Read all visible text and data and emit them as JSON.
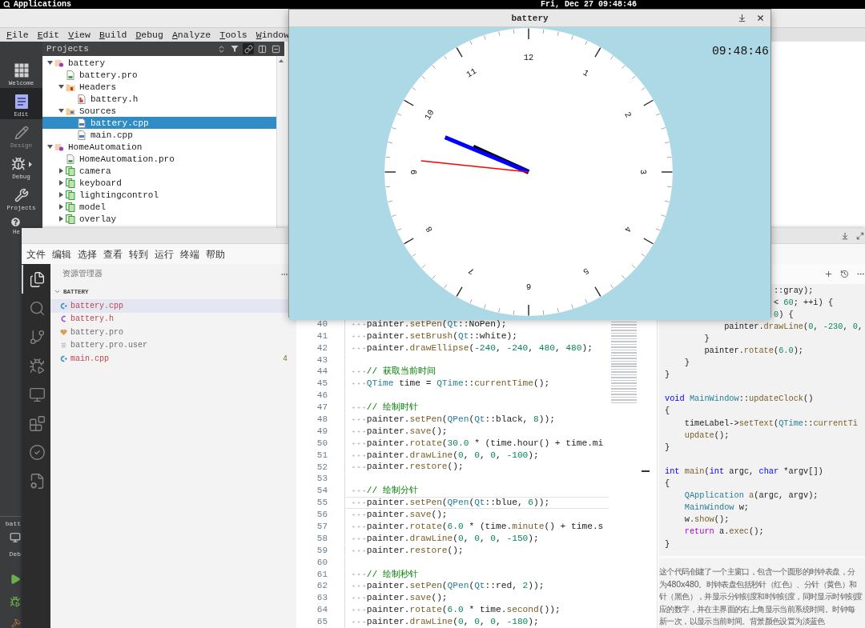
{
  "top_bar": {
    "menu": "Applications",
    "date_time": "Fri, Dec 27 09:48:46"
  },
  "qt_creator": {
    "menu": [
      "File",
      "Edit",
      "View",
      "Build",
      "Debug",
      "Analyze",
      "Tools",
      "Window"
    ],
    "modes": [
      {
        "kind": "welcome",
        "label": "Welcome",
        "selected": false,
        "disabled": false
      },
      {
        "kind": "edit",
        "label": "Edit",
        "selected": true,
        "disabled": false
      },
      {
        "kind": "design",
        "label": "Design",
        "selected": false,
        "disabled": true
      },
      {
        "kind": "debug",
        "label": "Debug",
        "selected": false,
        "disabled": false
      },
      {
        "kind": "projects",
        "label": "Projects",
        "selected": false,
        "disabled": false
      },
      {
        "kind": "help",
        "label": "He",
        "selected": false,
        "disabled": false
      }
    ],
    "kit": {
      "project": "batt",
      "build": "Deb"
    },
    "run_buttons": [
      {
        "kind": "run"
      },
      {
        "kind": "debug"
      },
      {
        "kind": "build"
      }
    ],
    "projects_panel": {
      "title": "Projects",
      "tools": [
        {
          "kind": "sort",
          "on": false
        },
        {
          "kind": "filter",
          "on": false
        },
        {
          "kind": "link",
          "on": true
        },
        {
          "kind": "split",
          "on": false
        },
        {
          "kind": "close",
          "on": false
        }
      ],
      "tree": [
        {
          "kind": "project",
          "label": "battery",
          "expanded": true,
          "selected": false,
          "children": [
            {
              "kind": "pro_file",
              "label": "battery.pro",
              "selected": false
            },
            {
              "kind": "headers",
              "label": "Headers",
              "expanded": true,
              "selected": false,
              "children": [
                {
                  "kind": "header_file",
                  "label": "battery.h",
                  "selected": false
                }
              ]
            },
            {
              "kind": "sources",
              "label": "Sources",
              "expanded": true,
              "selected": false,
              "children": [
                {
                  "kind": "cpp_file",
                  "label": "battery.cpp",
                  "selected": true
                },
                {
                  "kind": "cpp_file",
                  "label": "main.cpp",
                  "selected": false
                }
              ]
            }
          ]
        },
        {
          "kind": "project",
          "label": "HomeAutomation",
          "expanded": true,
          "selected": false,
          "children": [
            {
              "kind": "pro_file",
              "label": "HomeAutomation.pro",
              "selected": false
            },
            {
              "kind": "subproject",
              "label": "camera",
              "expanded": false,
              "selected": false
            },
            {
              "kind": "subproject",
              "label": "keyboard",
              "expanded": false,
              "selected": false
            },
            {
              "kind": "subproject",
              "label": "lightingcontrol",
              "expanded": false,
              "selected": false
            },
            {
              "kind": "subproject",
              "label": "model",
              "expanded": false,
              "selected": false
            },
            {
              "kind": "subproject",
              "label": "overlay",
              "expanded": false,
              "selected": false
            }
          ]
        }
      ]
    }
  },
  "clock_window": {
    "title": "battery",
    "time": "09:48:46",
    "dial_numbers": [
      "12",
      "1",
      "2",
      "3",
      "4",
      "5",
      "6",
      "7",
      "8",
      "9",
      "10",
      "11"
    ],
    "hands": [
      {
        "kind": "hour",
        "color": "#000000"
      },
      {
        "kind": "minute",
        "color": "#0000ff"
      },
      {
        "kind": "second",
        "color": "#ff0000"
      }
    ]
  },
  "vscode": {
    "menu": [
      "文件",
      "编辑",
      "选择",
      "查看",
      "转到",
      "运行",
      "终端",
      "帮助"
    ],
    "activity_bar": [
      {
        "kind": "explorer",
        "selected": true
      },
      {
        "kind": "search",
        "selected": false
      },
      {
        "kind": "source_control",
        "selected": false
      },
      {
        "kind": "run",
        "selected": false
      },
      {
        "kind": "remote",
        "selected": false
      },
      {
        "kind": "extensions",
        "selected": false
      },
      {
        "kind": "testing",
        "selected": false
      },
      {
        "kind": "cpp",
        "selected": false
      }
    ],
    "explorer": {
      "title": "资源管理器",
      "folder": {
        "label": "BATTERY",
        "expanded": true
      },
      "files": [
        {
          "kind": "cpp",
          "name": "battery.cpp",
          "selected": true,
          "error": true
        },
        {
          "kind": "header",
          "name": "battery.h",
          "selected": false,
          "error": true
        },
        {
          "kind": "project",
          "name": "battery.pro",
          "selected": false,
          "error": false
        },
        {
          "kind": "text",
          "name": "battery.pro.user",
          "selected": false,
          "error": false
        },
        {
          "kind": "cpp",
          "name": "main.cpp",
          "selected": false,
          "error": true,
          "problems": "4"
        }
      ]
    },
    "editor": {
      "lines": [
        {
          "number": "40",
          "current": false,
          "tokens": [
            {
              "kind": "plain",
              "text": "    painter."
            },
            {
              "kind": "function",
              "text": "setPen"
            },
            {
              "kind": "plain",
              "text": "("
            },
            {
              "kind": "type",
              "text": "Qt"
            },
            {
              "kind": "plain",
              "text": "::NoPen);"
            }
          ]
        },
        {
          "number": "41",
          "current": false,
          "tokens": [
            {
              "kind": "plain",
              "text": "    painter."
            },
            {
              "kind": "function",
              "text": "setBrush"
            },
            {
              "kind": "plain",
              "text": "("
            },
            {
              "kind": "type",
              "text": "Qt"
            },
            {
              "kind": "plain",
              "text": "::white);"
            }
          ]
        },
        {
          "number": "42",
          "current": false,
          "tokens": [
            {
              "kind": "plain",
              "text": "    painter."
            },
            {
              "kind": "function",
              "text": "drawEllipse"
            },
            {
              "kind": "plain",
              "text": "("
            },
            {
              "kind": "number",
              "text": "-240"
            },
            {
              "kind": "plain",
              "text": ", "
            },
            {
              "kind": "number",
              "text": "-240"
            },
            {
              "kind": "plain",
              "text": ", "
            },
            {
              "kind": "number",
              "text": "480"
            },
            {
              "kind": "plain",
              "text": ", "
            },
            {
              "kind": "number",
              "text": "480"
            },
            {
              "kind": "plain",
              "text": ");"
            }
          ]
        },
        {
          "number": "43",
          "current": false
        },
        {
          "number": "44",
          "current": false,
          "tokens": [
            {
              "kind": "comment",
              "text": "    // 获取当前时间"
            }
          ]
        },
        {
          "number": "45",
          "current": false,
          "tokens": [
            {
              "kind": "type",
              "text": "    QTime"
            },
            {
              "kind": "plain",
              "text": " time = "
            },
            {
              "kind": "type",
              "text": "QTime"
            },
            {
              "kind": "plain",
              "text": "::"
            },
            {
              "kind": "function",
              "text": "currentTime"
            },
            {
              "kind": "plain",
              "text": "();"
            }
          ]
        },
        {
          "number": "46",
          "current": false
        },
        {
          "number": "47",
          "current": false,
          "tokens": [
            {
              "kind": "comment",
              "text": "    // 绘制时针"
            }
          ]
        },
        {
          "number": "48",
          "current": false,
          "tokens": [
            {
              "kind": "plain",
              "text": "    painter."
            },
            {
              "kind": "function",
              "text": "setPen"
            },
            {
              "kind": "plain",
              "text": "("
            },
            {
              "kind": "type",
              "text": "QPen"
            },
            {
              "kind": "plain",
              "text": "("
            },
            {
              "kind": "type",
              "text": "Qt"
            },
            {
              "kind": "plain",
              "text": "::black, "
            },
            {
              "kind": "number",
              "text": "8"
            },
            {
              "kind": "plain",
              "text": "));"
            }
          ]
        },
        {
          "number": "49",
          "current": false,
          "tokens": [
            {
              "kind": "plain",
              "text": "    painter."
            },
            {
              "kind": "function",
              "text": "save"
            },
            {
              "kind": "plain",
              "text": "();"
            }
          ]
        },
        {
          "number": "50",
          "current": false,
          "tokens": [
            {
              "kind": "plain",
              "text": "    painter."
            },
            {
              "kind": "function",
              "text": "rotate"
            },
            {
              "kind": "plain",
              "text": "("
            },
            {
              "kind": "number",
              "text": "30.0"
            },
            {
              "kind": "plain",
              "text": " * (time.hour() + time.mi"
            }
          ]
        },
        {
          "number": "51",
          "current": false,
          "tokens": [
            {
              "kind": "plain",
              "text": "    painter."
            },
            {
              "kind": "function",
              "text": "drawLine"
            },
            {
              "kind": "plain",
              "text": "("
            },
            {
              "kind": "number",
              "text": "0"
            },
            {
              "kind": "plain",
              "text": ", "
            },
            {
              "kind": "number",
              "text": "0"
            },
            {
              "kind": "plain",
              "text": ", "
            },
            {
              "kind": "number",
              "text": "0"
            },
            {
              "kind": "plain",
              "text": ", "
            },
            {
              "kind": "number",
              "text": "-100"
            },
            {
              "kind": "plain",
              "text": ");"
            }
          ]
        },
        {
          "number": "52",
          "current": false,
          "tokens": [
            {
              "kind": "plain",
              "text": "    painter."
            },
            {
              "kind": "function",
              "text": "restore"
            },
            {
              "kind": "plain",
              "text": "();"
            }
          ]
        },
        {
          "number": "53",
          "current": false
        },
        {
          "number": "54",
          "current": false,
          "tokens": [
            {
              "kind": "comment",
              "text": "    // 绘制分针"
            }
          ]
        },
        {
          "number": "55",
          "current": true,
          "tokens": [
            {
              "kind": "plain",
              "text": "    painter."
            },
            {
              "kind": "function",
              "text": "setPen"
            },
            {
              "kind": "plain",
              "text": "("
            },
            {
              "kind": "type",
              "text": "QPen"
            },
            {
              "kind": "plain",
              "text": "("
            },
            {
              "kind": "type",
              "text": "Qt"
            },
            {
              "kind": "plain",
              "text": "::blue, "
            },
            {
              "kind": "number",
              "text": "6"
            },
            {
              "kind": "plain",
              "text": "));"
            }
          ]
        },
        {
          "number": "56",
          "current": false,
          "tokens": [
            {
              "kind": "plain",
              "text": "    painter."
            },
            {
              "kind": "function",
              "text": "save"
            },
            {
              "kind": "plain",
              "text": "();"
            }
          ]
        },
        {
          "number": "57",
          "current": false,
          "tokens": [
            {
              "kind": "plain",
              "text": "    painter."
            },
            {
              "kind": "function",
              "text": "rotate"
            },
            {
              "kind": "plain",
              "text": "("
            },
            {
              "kind": "number",
              "text": "6.0"
            },
            {
              "kind": "plain",
              "text": " * (time."
            },
            {
              "kind": "function",
              "text": "minute"
            },
            {
              "kind": "plain",
              "text": "() + time.s"
            }
          ]
        },
        {
          "number": "58",
          "current": false,
          "tokens": [
            {
              "kind": "plain",
              "text": "    painter."
            },
            {
              "kind": "function",
              "text": "drawLine"
            },
            {
              "kind": "plain",
              "text": "("
            },
            {
              "kind": "number",
              "text": "0"
            },
            {
              "kind": "plain",
              "text": ", "
            },
            {
              "kind": "number",
              "text": "0"
            },
            {
              "kind": "plain",
              "text": ", "
            },
            {
              "kind": "number",
              "text": "0"
            },
            {
              "kind": "plain",
              "text": ", "
            },
            {
              "kind": "number",
              "text": "-150"
            },
            {
              "kind": "plain",
              "text": ");"
            }
          ]
        },
        {
          "number": "59",
          "current": false,
          "tokens": [
            {
              "kind": "plain",
              "text": "    painter."
            },
            {
              "kind": "function",
              "text": "restore"
            },
            {
              "kind": "plain",
              "text": "();"
            }
          ]
        },
        {
          "number": "60",
          "current": false
        },
        {
          "number": "61",
          "current": false,
          "tokens": [
            {
              "kind": "comment",
              "text": "    // 绘制秒针"
            }
          ]
        },
        {
          "number": "62",
          "current": false,
          "tokens": [
            {
              "kind": "plain",
              "text": "    painter."
            },
            {
              "kind": "function",
              "text": "setPen"
            },
            {
              "kind": "plain",
              "text": "("
            },
            {
              "kind": "type",
              "text": "QPen"
            },
            {
              "kind": "plain",
              "text": "("
            },
            {
              "kind": "type",
              "text": "Qt"
            },
            {
              "kind": "plain",
              "text": "::red, "
            },
            {
              "kind": "number",
              "text": "2"
            },
            {
              "kind": "plain",
              "text": "));"
            }
          ]
        },
        {
          "number": "63",
          "current": false,
          "tokens": [
            {
              "kind": "plain",
              "text": "    painter."
            },
            {
              "kind": "function",
              "text": "save"
            },
            {
              "kind": "plain",
              "text": "();"
            }
          ]
        },
        {
          "number": "64",
          "current": false,
          "tokens": [
            {
              "kind": "plain",
              "text": "    painter."
            },
            {
              "kind": "function",
              "text": "rotate"
            },
            {
              "kind": "plain",
              "text": "("
            },
            {
              "kind": "number",
              "text": "6.0"
            },
            {
              "kind": "plain",
              "text": " * time."
            },
            {
              "kind": "function",
              "text": "second"
            },
            {
              "kind": "plain",
              "text": "());"
            }
          ]
        },
        {
          "number": "65",
          "current": false,
          "tokens": [
            {
              "kind": "plain",
              "text": "    painter."
            },
            {
              "kind": "function",
              "text": "drawLine"
            },
            {
              "kind": "plain",
              "text": "("
            },
            {
              "kind": "number",
              "text": "0"
            },
            {
              "kind": "plain",
              "text": ", "
            },
            {
              "kind": "number",
              "text": "0"
            },
            {
              "kind": "plain",
              "text": ", "
            },
            {
              "kind": "number",
              "text": "0"
            },
            {
              "kind": "plain",
              "text": ", "
            },
            {
              "kind": "number",
              "text": "-180"
            },
            {
              "kind": "plain",
              "text": ");"
            }
          ]
        }
      ]
    },
    "chat_panel": {
      "code_lines": [
        {
          "kind": "code",
          "tokens": [
            {
              "kind": "plain",
              "text": "                      ::gray);"
            }
          ]
        },
        {
          "kind": "code",
          "tokens": [
            {
              "kind": "plain",
              "text": "                      < "
            },
            {
              "kind": "number",
              "text": "60"
            },
            {
              "kind": "plain",
              "text": "; ++i) {"
            }
          ]
        },
        {
          "kind": "code",
          "tokens": [
            {
              "kind": "number",
              "text": "                      0"
            },
            {
              "kind": "plain",
              "text": ") {"
            }
          ]
        },
        {
          "kind": "code",
          "tokens": [
            {
              "kind": "plain",
              "text": "            painter."
            },
            {
              "kind": "function",
              "text": "drawLine"
            },
            {
              "kind": "plain",
              "text": "("
            },
            {
              "kind": "number",
              "text": "0"
            },
            {
              "kind": "plain",
              "text": ", "
            },
            {
              "kind": "number",
              "text": "-230"
            },
            {
              "kind": "plain",
              "text": ", "
            },
            {
              "kind": "number",
              "text": "0"
            },
            {
              "kind": "plain",
              "text": ","
            }
          ]
        },
        {
          "kind": "code",
          "tokens": [
            {
              "kind": "plain",
              "text": "        }"
            }
          ]
        },
        {
          "kind": "code",
          "tokens": [
            {
              "kind": "plain",
              "text": "        painter."
            },
            {
              "kind": "function",
              "text": "rotate"
            },
            {
              "kind": "plain",
              "text": "("
            },
            {
              "kind": "number",
              "text": "6.0"
            },
            {
              "kind": "plain",
              "text": ");"
            }
          ]
        },
        {
          "kind": "code",
          "tokens": [
            {
              "kind": "plain",
              "text": "    }"
            }
          ]
        },
        {
          "kind": "code",
          "tokens": [
            {
              "kind": "plain",
              "text": "}"
            }
          ]
        },
        {
          "kind": "blank"
        },
        {
          "kind": "code",
          "tokens": [
            {
              "kind": "keyword",
              "text": "void"
            },
            {
              "kind": "type",
              "text": " MainWindow"
            },
            {
              "kind": "plain",
              "text": "::"
            },
            {
              "kind": "function",
              "text": "updateClock"
            },
            {
              "kind": "plain",
              "text": "()"
            }
          ]
        },
        {
          "kind": "code",
          "tokens": [
            {
              "kind": "plain",
              "text": "{"
            }
          ]
        },
        {
          "kind": "code",
          "tokens": [
            {
              "kind": "plain",
              "text": "    timeLabel->"
            },
            {
              "kind": "function",
              "text": "setText"
            },
            {
              "kind": "plain",
              "text": "("
            },
            {
              "kind": "type",
              "text": "QTime"
            },
            {
              "kind": "plain",
              "text": "::"
            },
            {
              "kind": "function",
              "text": "currentTi"
            }
          ]
        },
        {
          "kind": "code",
          "tokens": [
            {
              "kind": "function",
              "text": "    update"
            },
            {
              "kind": "plain",
              "text": "();"
            }
          ]
        },
        {
          "kind": "code",
          "tokens": [
            {
              "kind": "plain",
              "text": "}"
            }
          ]
        },
        {
          "kind": "blank"
        },
        {
          "kind": "code",
          "tokens": [
            {
              "kind": "keyword",
              "text": "int"
            },
            {
              "kind": "function",
              "text": " main"
            },
            {
              "kind": "plain",
              "text": "("
            },
            {
              "kind": "keyword",
              "text": "int"
            },
            {
              "kind": "plain",
              "text": " argc, "
            },
            {
              "kind": "keyword",
              "text": "char"
            },
            {
              "kind": "plain",
              "text": " *argv[])"
            }
          ]
        },
        {
          "kind": "code",
          "tokens": [
            {
              "kind": "plain",
              "text": "{"
            }
          ]
        },
        {
          "kind": "code",
          "tokens": [
            {
              "kind": "type",
              "text": "    QApplication"
            },
            {
              "kind": "function",
              "text": " a"
            },
            {
              "kind": "plain",
              "text": "(argc, argv);"
            }
          ]
        },
        {
          "kind": "code",
          "tokens": [
            {
              "kind": "type",
              "text": "    MainWindow"
            },
            {
              "kind": "plain",
              "text": " w;"
            }
          ]
        },
        {
          "kind": "code",
          "tokens": [
            {
              "kind": "plain",
              "text": "    w."
            },
            {
              "kind": "function",
              "text": "show"
            },
            {
              "kind": "plain",
              "text": "();"
            }
          ]
        },
        {
          "kind": "code",
          "tokens": [
            {
              "kind": "control",
              "text": "    return"
            },
            {
              "kind": "plain",
              "text": " a."
            },
            {
              "kind": "function",
              "text": "exec"
            },
            {
              "kind": "plain",
              "text": "();"
            }
          ]
        },
        {
          "kind": "code",
          "tokens": [
            {
              "kind": "plain",
              "text": "}"
            }
          ]
        }
      ],
      "description": [
        "这个代码创建了一个主窗口，包含一个圆形的时钟表盘，分",
        "为480x480。时钟表盘包括秒针（红色）、分针（黄色）和",
        "针（黑色），并显示分钟刻度和时钟刻度，同时显示时钟刻度",
        "应的数字，并在主界面的右上角显示当前系统时间。时钟每",
        "新一次，以显示当前时间。背景颜色设置为淡蓝色"
      ]
    }
  }
}
